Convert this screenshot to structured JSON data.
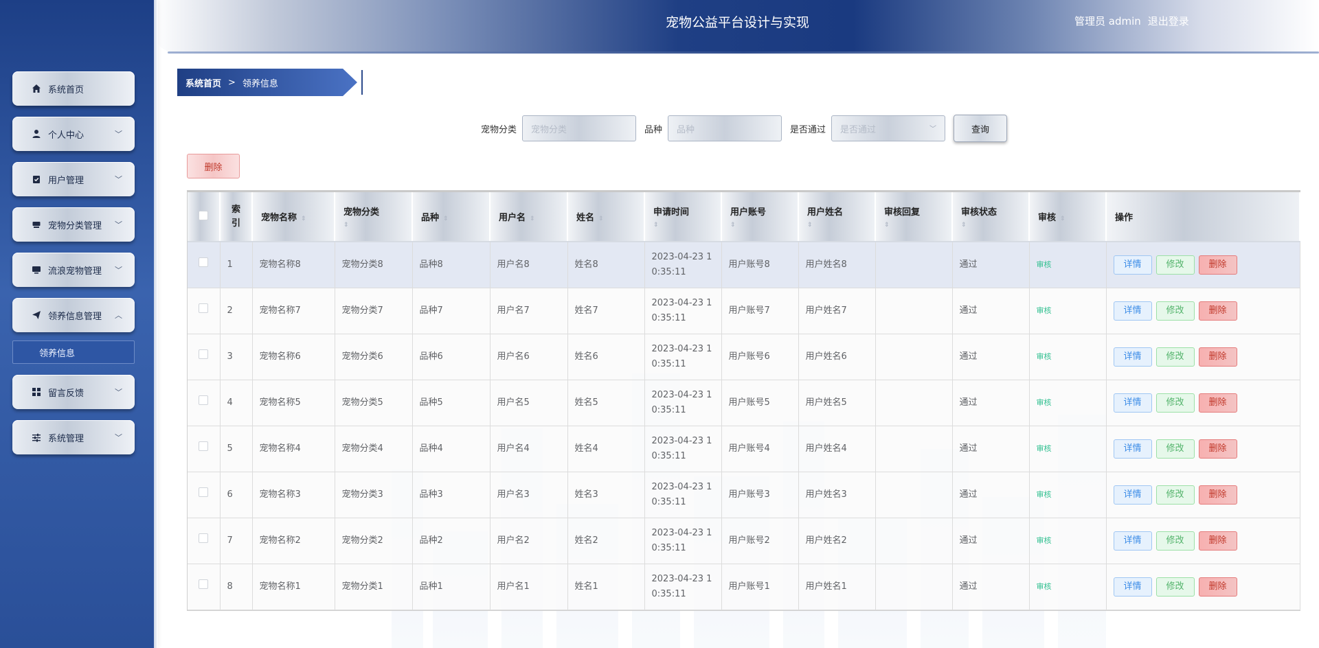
{
  "app": {
    "title": "宠物公益平台设计与实现"
  },
  "user": {
    "role_name": "管理员 admin",
    "logout": "退出登录"
  },
  "sidebar": {
    "items": [
      {
        "label": "系统首页",
        "icon": "home-icon",
        "expandable": false
      },
      {
        "label": "个人中心",
        "icon": "user-icon",
        "expandable": true
      },
      {
        "label": "用户管理",
        "icon": "clipboard-check-icon",
        "expandable": true
      },
      {
        "label": "宠物分类管理",
        "icon": "tray-icon",
        "expandable": true
      },
      {
        "label": "流浪宠物管理",
        "icon": "monitor-icon",
        "expandable": true
      },
      {
        "label": "领养信息管理",
        "icon": "send-icon",
        "expandable": true,
        "expanded": true
      },
      {
        "label": "留言反馈",
        "icon": "grid-icon",
        "expandable": true
      },
      {
        "label": "系统管理",
        "icon": "sliders-icon",
        "expandable": true
      }
    ],
    "submenu_active": "领养信息"
  },
  "breadcrumb": {
    "home": "系统首页",
    "separator": ">",
    "current": "领养信息"
  },
  "search": {
    "category_label": "宠物分类",
    "category_placeholder": "宠物分类",
    "breed_label": "品种",
    "breed_placeholder": "品种",
    "passed_label": "是否通过",
    "passed_placeholder": "是否通过",
    "query_button": "查询"
  },
  "batch_delete": "删除",
  "table": {
    "headers": {
      "index": "索引",
      "pet_name": "宠物名称",
      "category": "宠物分类",
      "breed": "品种",
      "username": "用户名",
      "name": "姓名",
      "apply_time": "申请时间",
      "account": "用户账号",
      "user_fullname": "用户姓名",
      "review_reply": "审核回复",
      "review_status": "审核状态",
      "review": "审核",
      "actions": "操作"
    },
    "rows": [
      {
        "index": "1",
        "pet_name": "宠物名称8",
        "category": "宠物分类8",
        "breed": "品种8",
        "username": "用户名8",
        "name": "姓名8",
        "time_a": "2023-04-23 1",
        "time_b": "0:35:11",
        "account": "用户账号8",
        "fullname": "用户姓名8",
        "reply": "",
        "status": "通过",
        "review": "审核"
      },
      {
        "index": "2",
        "pet_name": "宠物名称7",
        "category": "宠物分类7",
        "breed": "品种7",
        "username": "用户名7",
        "name": "姓名7",
        "time_a": "2023-04-23 1",
        "time_b": "0:35:11",
        "account": "用户账号7",
        "fullname": "用户姓名7",
        "reply": "",
        "status": "通过",
        "review": "审核"
      },
      {
        "index": "3",
        "pet_name": "宠物名称6",
        "category": "宠物分类6",
        "breed": "品种6",
        "username": "用户名6",
        "name": "姓名6",
        "time_a": "2023-04-23 1",
        "time_b": "0:35:11",
        "account": "用户账号6",
        "fullname": "用户姓名6",
        "reply": "",
        "status": "通过",
        "review": "审核"
      },
      {
        "index": "4",
        "pet_name": "宠物名称5",
        "category": "宠物分类5",
        "breed": "品种5",
        "username": "用户名5",
        "name": "姓名5",
        "time_a": "2023-04-23 1",
        "time_b": "0:35:11",
        "account": "用户账号5",
        "fullname": "用户姓名5",
        "reply": "",
        "status": "通过",
        "review": "审核"
      },
      {
        "index": "5",
        "pet_name": "宠物名称4",
        "category": "宠物分类4",
        "breed": "品种4",
        "username": "用户名4",
        "name": "姓名4",
        "time_a": "2023-04-23 1",
        "time_b": "0:35:11",
        "account": "用户账号4",
        "fullname": "用户姓名4",
        "reply": "",
        "status": "通过",
        "review": "审核"
      },
      {
        "index": "6",
        "pet_name": "宠物名称3",
        "category": "宠物分类3",
        "breed": "品种3",
        "username": "用户名3",
        "name": "姓名3",
        "time_a": "2023-04-23 1",
        "time_b": "0:35:11",
        "account": "用户账号3",
        "fullname": "用户姓名3",
        "reply": "",
        "status": "通过",
        "review": "审核"
      },
      {
        "index": "7",
        "pet_name": "宠物名称2",
        "category": "宠物分类2",
        "breed": "品种2",
        "username": "用户名2",
        "name": "姓名2",
        "time_a": "2023-04-23 1",
        "time_b": "0:35:11",
        "account": "用户账号2",
        "fullname": "用户姓名2",
        "reply": "",
        "status": "通过",
        "review": "审核"
      },
      {
        "index": "8",
        "pet_name": "宠物名称1",
        "category": "宠物分类1",
        "breed": "品种1",
        "username": "用户名1",
        "name": "姓名1",
        "time_a": "2023-04-23 1",
        "time_b": "0:35:11",
        "account": "用户账号1",
        "fullname": "用户姓名1",
        "reply": "",
        "status": "通过",
        "review": "审核"
      }
    ],
    "row_actions": {
      "detail": "详情",
      "edit": "修改",
      "delete": "删除"
    }
  },
  "colors": {
    "sidebar_top": "#1d3f86",
    "accent": "#1f3f84",
    "detail": "#3c8ce7",
    "edit": "#52b36a",
    "delete": "#c0392b",
    "audit": "#2fbf8f"
  }
}
